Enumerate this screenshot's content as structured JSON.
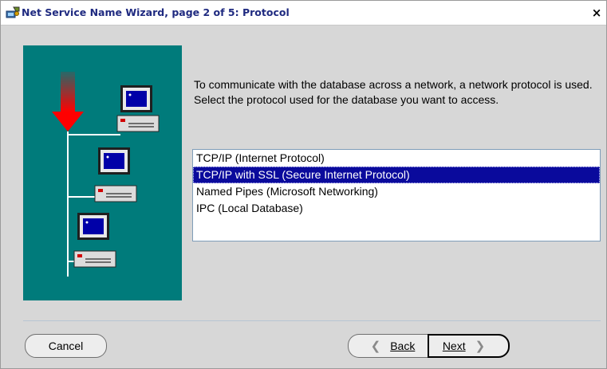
{
  "window": {
    "title": "Net Service Name Wizard, page 2 of 5: Protocol",
    "close_label": "×"
  },
  "illustration": {
    "icon": "network-computers-illustration",
    "background_color": "#007b7b",
    "arrow_color": "#ff0000"
  },
  "description": "To communicate with the database across a network, a network protocol is used.  Select the protocol used for the database you want to access.",
  "protocol_list": {
    "items": [
      {
        "label": "TCP/IP (Internet Protocol)",
        "selected": false
      },
      {
        "label": "TCP/IP with SSL (Secure Internet Protocol)",
        "selected": true
      },
      {
        "label": "Named Pipes (Microsoft Networking)",
        "selected": false
      },
      {
        "label": "IPC (Local Database)",
        "selected": false
      }
    ]
  },
  "buttons": {
    "cancel": "Cancel",
    "back": "Back",
    "back_icon": "chevron-left-icon",
    "next": "Next",
    "next_icon": "chevron-right-icon"
  },
  "colors": {
    "selection": "#0a0a9c",
    "title_text": "#1f2a80"
  }
}
